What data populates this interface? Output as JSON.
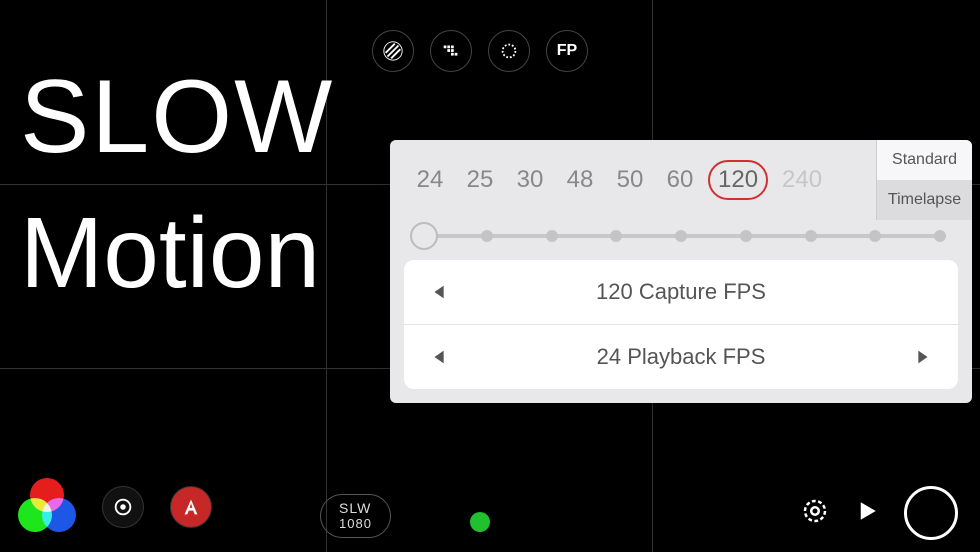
{
  "title": {
    "line1": "SLOW",
    "line2": "Motion"
  },
  "top_icons": {
    "zebra": "zebra-icon",
    "peaking": "peaking-icon",
    "gear": "gear-icon",
    "fp": "FP"
  },
  "mode_badge": {
    "mode": "SLW",
    "resolution": "1080"
  },
  "fps_panel": {
    "options": [
      "24",
      "25",
      "30",
      "48",
      "50",
      "60",
      "120",
      "240"
    ],
    "selected": "120",
    "disabled": [
      "240"
    ],
    "tabs": {
      "standard": "Standard",
      "timelapse": "Timelapse",
      "active": "standard"
    },
    "capture_label": "120 Capture FPS",
    "playback_label": "24 Playback FPS"
  }
}
